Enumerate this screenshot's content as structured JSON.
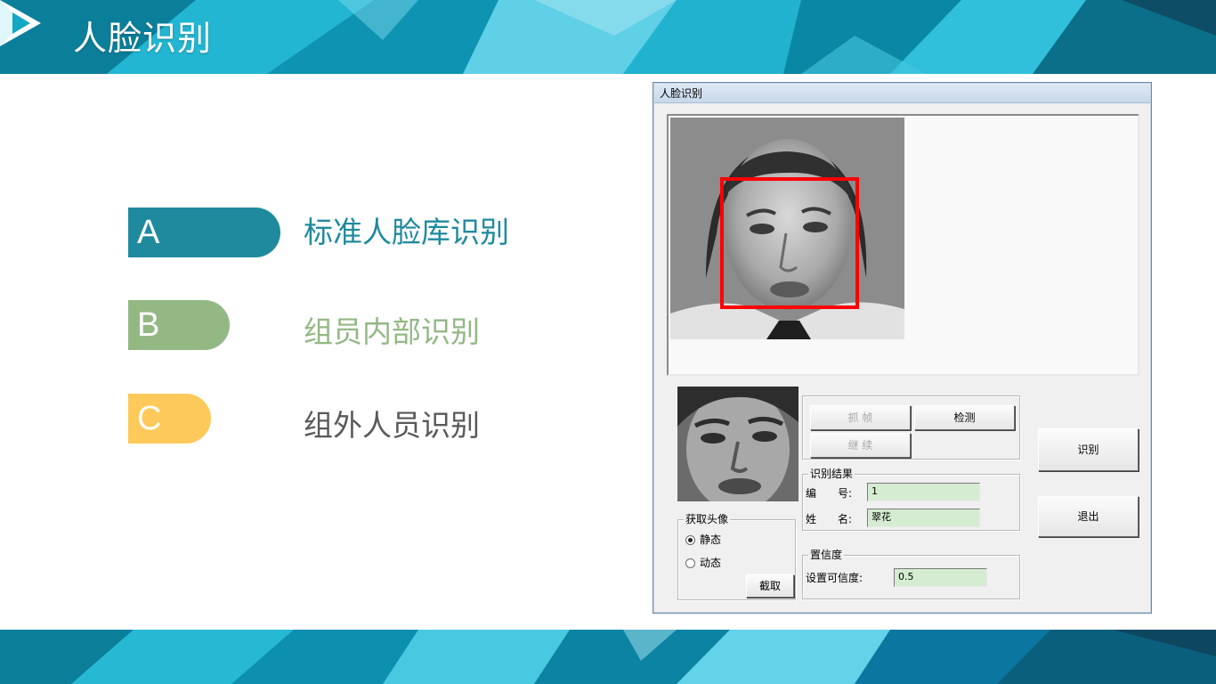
{
  "header": {
    "title": "人脸识别"
  },
  "colors": {
    "accent_teal": "#1f8a9e",
    "accent_green": "#93b884",
    "accent_yellow": "#fdc95a",
    "label_gray": "#595959"
  },
  "options": [
    {
      "letter": "A",
      "label": "标准人脸库识别"
    },
    {
      "letter": "B",
      "label": "组员内部识别"
    },
    {
      "letter": "C",
      "label": "组外人员识别"
    }
  ],
  "dialog": {
    "title": "人脸识别",
    "buttons": {
      "grab_frame": "抓 帧",
      "detect": "检测",
      "continue": "继 续",
      "recognize": "识别",
      "exit": "退出",
      "capture": "截取"
    },
    "capture_group": {
      "legend": "获取头像",
      "options": [
        "静态",
        "动态"
      ],
      "selected": "静态"
    },
    "result_group": {
      "legend": "识别结果",
      "id_label": "编　　号:",
      "id_value": "1",
      "name_label": "姓　　名:",
      "name_value": "翠花"
    },
    "confidence_group": {
      "legend": "置信度",
      "label": "设置可信度:",
      "value": "0.5"
    }
  }
}
